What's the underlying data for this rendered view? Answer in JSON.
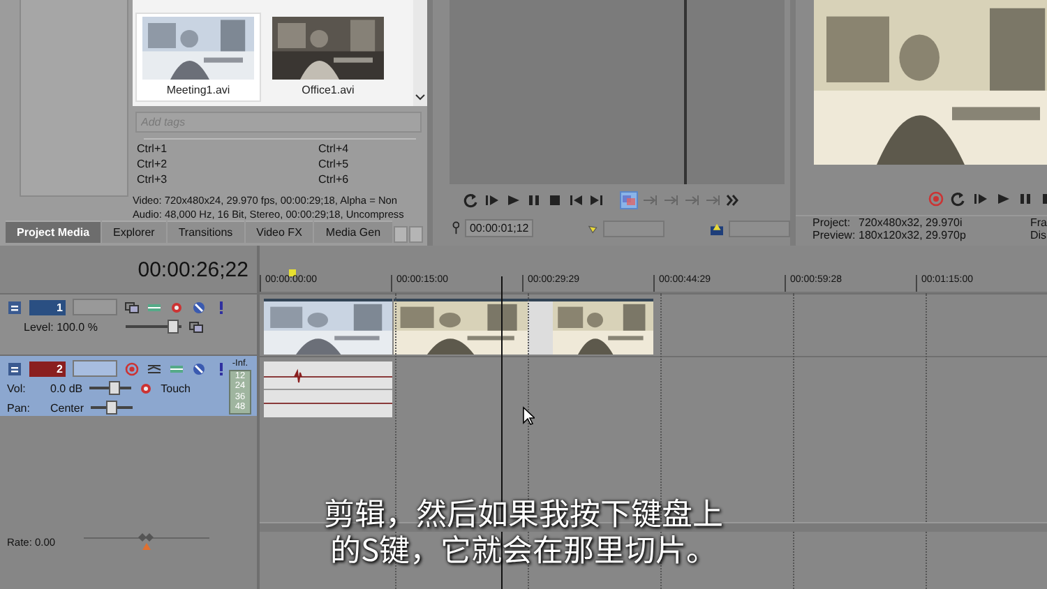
{
  "media": {
    "items": [
      {
        "name": "Meeting1.avi",
        "selected": true
      },
      {
        "name": "Office1.avi",
        "selected": false
      }
    ],
    "tags": {
      "placeholder": "Add tags"
    },
    "shortcuts": [
      "Ctrl+1",
      "Ctrl+4",
      "Ctrl+2",
      "Ctrl+5",
      "Ctrl+3",
      "Ctrl+6"
    ],
    "info": [
      "Video: 720x480x24, 29.970 fps, 00:00:29;18, Alpha = Non",
      "Audio: 48,000 Hz, 16 Bit, Stereo, 00:00:29;18, Uncompress"
    ]
  },
  "tabs": [
    {
      "label": "Project Media",
      "selected": true
    },
    {
      "label": "Explorer",
      "selected": false
    },
    {
      "label": "Transitions",
      "selected": false
    },
    {
      "label": "Video FX",
      "selected": false
    },
    {
      "label": "Media Gen",
      "selected": false
    }
  ],
  "trimmer": {
    "timecode": "00:00:01;12"
  },
  "preview": {
    "lines": [
      {
        "label": "Project:",
        "value": "720x480x32, 29.970i",
        "extra": "Fra"
      },
      {
        "label": "Preview:",
        "value": "180x120x32, 29.970p",
        "extra": "Dis"
      }
    ]
  },
  "timeline": {
    "timecode": "00:00:26;22",
    "ruler": [
      "00:00:00:00",
      "00:00:15:00",
      "00:00:29:29",
      "00:00:44:29",
      "00:00:59:28",
      "00:01:15:00"
    ]
  },
  "tracks": [
    {
      "kind": "video",
      "number": "1",
      "selected": false,
      "label": "Level: 100.0 %",
      "level": 0.85
    },
    {
      "kind": "audio",
      "number": "2",
      "selected": true,
      "vol_label": "Vol:",
      "vol": "0.0 dB",
      "vol_slider": {
        "level": 0.6
      },
      "automation": "Touch",
      "pan_label": "Pan:",
      "pan": "Center",
      "pan_slider": {
        "level": 0.5
      },
      "meter": [
        "-Inf.",
        "12",
        "24",
        "36",
        "48"
      ]
    }
  ],
  "rate": {
    "label": "Rate: 0.00",
    "level": 0.5
  },
  "subtitles": [
    "剪辑，然后如果我按下键盘上",
    "的S键，它就会在那里切片。"
  ]
}
